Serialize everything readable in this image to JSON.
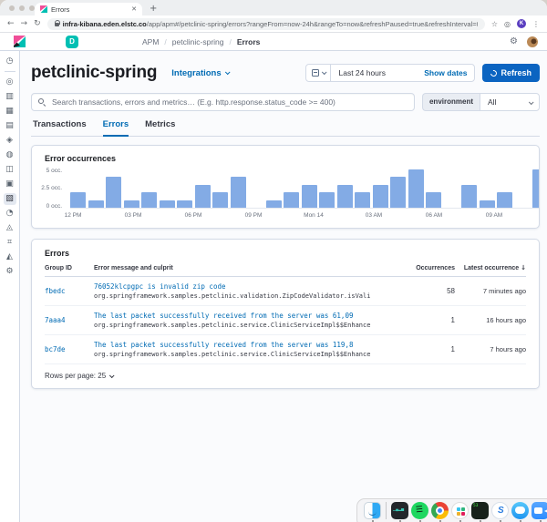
{
  "browser": {
    "tab_title": "Errors",
    "url_domain": "infra-kibana.eden.elstc.co",
    "url_path": "/app/apm#/petclinic-spring/errors?rangeFrom=now-24h&rangeTo=now&refreshPaused=true&refreshInterval=0",
    "profile_initial": "K"
  },
  "icons": {
    "back": "←",
    "forward": "→",
    "reload": "↻",
    "star": "☆",
    "extension": "◎",
    "kebab": "⋮",
    "close": "✕",
    "plus": "+",
    "slash": "/",
    "sort_arrow": "↓",
    "deployment": "⚙"
  },
  "kibana": {
    "space_initial": "D",
    "breadcrumbs": [
      "APM",
      "petclinic-spring",
      "Errors"
    ]
  },
  "sidebar": {
    "top_item": {
      "name": "recently-viewed",
      "glyph": "◷"
    },
    "items": [
      {
        "name": "discover",
        "glyph": "◎"
      },
      {
        "name": "visualize",
        "glyph": "▥"
      },
      {
        "name": "dashboard",
        "glyph": "▦"
      },
      {
        "name": "canvas",
        "glyph": "▤"
      },
      {
        "name": "maps",
        "glyph": "◈"
      },
      {
        "name": "machine-learning",
        "glyph": "◍"
      },
      {
        "name": "metrics",
        "glyph": "◫"
      },
      {
        "name": "logs",
        "glyph": "▣"
      },
      {
        "name": "apm",
        "glyph": "▧",
        "selected": true
      },
      {
        "name": "uptime",
        "glyph": "◔"
      },
      {
        "name": "siem",
        "glyph": "◬"
      },
      {
        "name": "dev-tools",
        "glyph": "⌗"
      },
      {
        "name": "stack-monitoring",
        "glyph": "◭"
      },
      {
        "name": "management",
        "glyph": "⚙"
      }
    ]
  },
  "page_header": {
    "title": "petclinic-spring",
    "integrations_label": "Integrations",
    "time_range": "Last 24 hours",
    "show_dates_label": "Show dates",
    "refresh_label": "Refresh"
  },
  "filters": {
    "search_placeholder": "Search transactions, errors and metrics… (E.g. http.response.status_code >= 400)",
    "environment_label": "environment",
    "environment_value": "All"
  },
  "tabs": [
    {
      "label": "Transactions",
      "active": false
    },
    {
      "label": "Errors",
      "active": true
    },
    {
      "label": "Metrics",
      "active": false
    }
  ],
  "chart_data": {
    "type": "bar",
    "title": "Error occurrences",
    "ylabel": "occurrences",
    "ylim": [
      0,
      5
    ],
    "y_ticks": [
      "5 occ.",
      "2.5 occ.",
      "0 occ."
    ],
    "values": [
      2,
      1,
      4,
      1,
      2,
      1,
      1,
      3,
      2,
      4,
      null,
      1,
      2,
      3,
      2,
      3,
      2,
      3,
      4,
      5,
      2,
      null,
      3,
      1,
      2,
      null,
      5
    ],
    "x_ticks": [
      {
        "label": "12 PM",
        "hour": 0
      },
      {
        "label": "03 PM",
        "hour": 3
      },
      {
        "label": "06 PM",
        "hour": 6
      },
      {
        "label": "09 PM",
        "hour": 9
      },
      {
        "label": "Mon 14",
        "hour": 12
      },
      {
        "label": "03 AM",
        "hour": 15
      },
      {
        "label": "06 AM",
        "hour": 18
      },
      {
        "label": "09 AM",
        "hour": 21
      }
    ],
    "bar_color": "#83abe5"
  },
  "errors_table": {
    "title": "Errors",
    "columns": [
      "Group ID",
      "Error message and culprit",
      "Occurrences",
      "Latest occurrence"
    ],
    "rows": [
      {
        "group_id": "fbedc",
        "message": "76052klcpgpc is invalid zip code",
        "culprit": "org.springframework.samples.petclinic.validation.ZipCodeValidator.isVali",
        "occurrences": "58",
        "latest": "7 minutes ago"
      },
      {
        "group_id": "7aaa4",
        "message": "The last packet successfully received from the server was 61,09",
        "culprit": "org.springframework.samples.petclinic.service.ClinicServiceImpl$$Enhance",
        "occurrences": "1",
        "latest": "16 hours ago"
      },
      {
        "group_id": "bc7de",
        "message": "The last packet successfully received from the server was 119,8",
        "culprit": "org.springframework.samples.petclinic.service.ClinicServiceImpl$$Enhance",
        "occurrences": "1",
        "latest": "7 hours ago"
      }
    ],
    "rows_per_page_label": "Rows per page: 25"
  },
  "dock": {
    "apps": [
      "finder",
      "terminal",
      "spotify",
      "chrome",
      "slack",
      "activity-terminal",
      "s-app",
      "messages",
      "zoom"
    ]
  }
}
